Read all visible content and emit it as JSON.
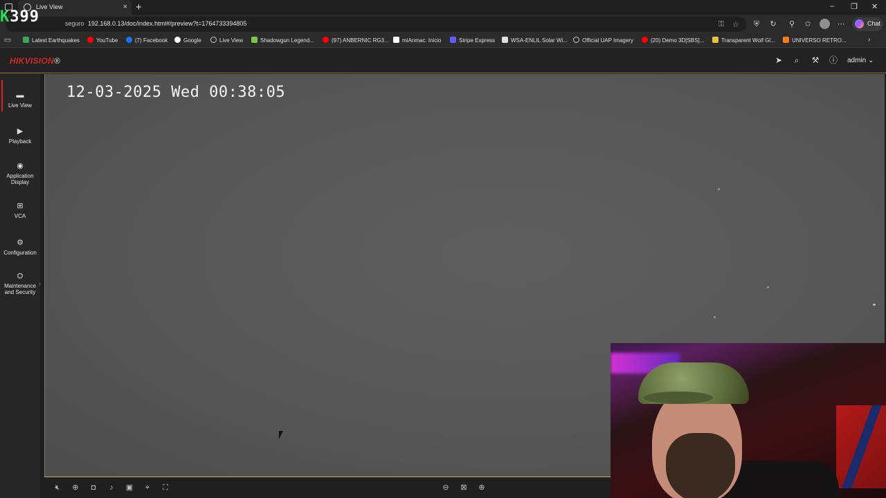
{
  "browser": {
    "tab_title": "Live View",
    "address_prefix": "seguro",
    "url": "192.168.0.13/doc/index.html#/preview?t=1764733394805",
    "overlay_counter_prefix": "K",
    "overlay_counter": "399",
    "chat_label": "Chat"
  },
  "bookmarks": [
    {
      "label": "Latest Earthquakes",
      "color": "#3aa55d"
    },
    {
      "label": "YouTube",
      "color": "#ff0000"
    },
    {
      "label": "(7) Facebook",
      "color": "#1877f2"
    },
    {
      "label": "Google",
      "color": "#ffffff"
    },
    {
      "label": "Live View",
      "color": "#cccccc"
    },
    {
      "label": "Shadowgun Legend...",
      "color": "#7ac943"
    },
    {
      "label": "(97) ANBERNIC RG3...",
      "color": "#ff0000"
    },
    {
      "label": "miAnmac. Inicio",
      "color": "#ffffff"
    },
    {
      "label": "Stripe Express",
      "color": "#635bff"
    },
    {
      "label": "WSA-ENLIL Solar Wi...",
      "color": "#e0e0e0"
    },
    {
      "label": "Official UAP Imagery",
      "color": "#cccccc"
    },
    {
      "label": "(20) Demo 3D[SBS]...",
      "color": "#ff0000"
    },
    {
      "label": "Transparent Wolf Gl...",
      "color": "#f0c040"
    },
    {
      "label": "UNIVERSO RETRO...",
      "color": "#ff7a1a"
    }
  ],
  "app": {
    "brand_main": "HIKVISION",
    "brand_mark": "®",
    "user": "admin",
    "user_caret": "⌄"
  },
  "nav": [
    {
      "label": "Live View",
      "icon": "monitor-icon"
    },
    {
      "label": "Playback",
      "icon": "playback-icon"
    },
    {
      "label": "Application Display",
      "icon": "application-icon"
    },
    {
      "label": "VCA",
      "icon": "vca-icon"
    },
    {
      "label": "Configuration",
      "icon": "gear-icon"
    },
    {
      "label": "Maintenance and Security",
      "icon": "maintenance-icon"
    }
  ],
  "video": {
    "osd_timestamp": "12-03-2025 Wed 00:38:05"
  }
}
